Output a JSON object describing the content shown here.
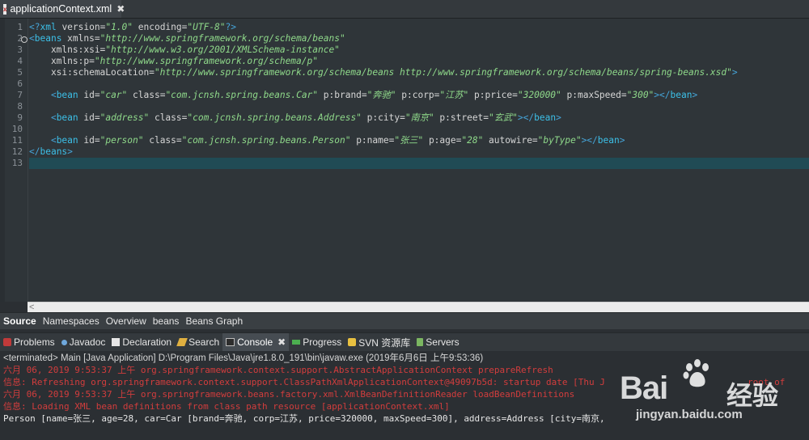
{
  "editor_tab": {
    "label": "applicationContext.xml",
    "close": "✖"
  },
  "line_numbers": [
    "1",
    "2",
    "3",
    "4",
    "5",
    "6",
    "7",
    "8",
    "9",
    "10",
    "11",
    "12",
    "13"
  ],
  "code": {
    "l1": {
      "p1": "<?",
      "t": "xml",
      "a1": " version=",
      "v1": "\"1.0\"",
      "a2": " encoding=",
      "v2": "\"UTF-8\"",
      "p2": "?>"
    },
    "l2": {
      "p1": "<",
      "t": "beans",
      "a1": " xmlns=",
      "v1": "\"http://www.springframework.org/schema/beans\""
    },
    "l3": {
      "a1": "    xmlns:xsi=",
      "v1": "\"http://www.w3.org/2001/XMLSchema-instance\""
    },
    "l4": {
      "a1": "    xmlns:p=",
      "v1": "\"http://www.springframework.org/schema/p\""
    },
    "l5": {
      "a1": "    xsi:schemaLocation=",
      "v1": "\"http://www.springframework.org/schema/beans http://www.springframework.org/schema/beans/spring-beans.xsd\"",
      "p2": ">"
    },
    "l7": {
      "p1": "    <",
      "t": "bean",
      "a1": " id=",
      "v1": "\"car\"",
      "a2": " class=",
      "v2": "\"com.jcnsh.spring.beans.Car\"",
      "a3": " p:brand=",
      "v3": "\"奔驰\"",
      "a4": " p:corp=",
      "v4": "\"江苏\"",
      "a5": " p:price=",
      "v5": "\"320000\"",
      "a6": " p:maxSpeed=",
      "v6": "\"300\"",
      "p2": "></",
      "t2": "bean",
      "p3": ">"
    },
    "l9": {
      "p1": "    <",
      "t": "bean",
      "a1": " id=",
      "v1": "\"address\"",
      "a2": " class=",
      "v2": "\"com.jcnsh.spring.beans.Address\"",
      "a3": " p:city=",
      "v3": "\"南京\"",
      "a4": " p:street=",
      "v4": "\"玄武\"",
      "p2": "></",
      "t2": "bean",
      "p3": ">"
    },
    "l11": {
      "p1": "    <",
      "t": "bean",
      "a1": " id=",
      "v1": "\"person\"",
      "a2": " class=",
      "v2": "\"com.jcnsh.spring.beans.Person\"",
      "a3": " p:name=",
      "v3": "\"张三\"",
      "a4": " p:age=",
      "v4": "\"28\"",
      "a5": " autowire=",
      "v5": "\"byType\"",
      "p2": "></",
      "t2": "bean",
      "p3": ">"
    },
    "l12": {
      "p1": "</",
      "t": "beans",
      "p2": ">"
    }
  },
  "page_tabs": [
    "Source",
    "Namespaces",
    "Overview",
    "beans",
    "Beans Graph"
  ],
  "view_tabs": [
    "Problems",
    "Javadoc",
    "Declaration",
    "Search",
    "Console",
    "Progress",
    "SVN 资源库",
    "Servers"
  ],
  "view_tab_close": "✖",
  "console": {
    "status": "<terminated> Main [Java Application] D:\\Program Files\\Java\\jre1.8.0_191\\bin\\javaw.exe (2019年6月6日 上午9:53:36)",
    "lines": [
      "六月 06, 2019 9:53:37 上午 org.springframework.context.support.AbstractApplicationContext prepareRefresh",
      "信息: Refreshing org.springframework.context.support.ClassPathXmlApplicationContext@49097b5d: startup date [Thu J",
      "六月 06, 2019 9:53:37 上午 org.springframework.beans.factory.xml.XmlBeanDefinitionReader loadBeanDefinitions",
      "信息: Loading XML bean definitions from class path resource [applicationContext.xml]",
      "Person [name=张三, age=28, car=Car [brand=奔驰, corp=江苏, price=320000, maxSpeed=300], address=Address [city=南京,"
    ],
    "line2_tail": "root of"
  },
  "watermark": {
    "brand": "Bai",
    "brand_cn": "经验",
    "url": "jingyan.baidu.com"
  },
  "colors": {
    "tag": "#3cc0e8",
    "value": "#8fd98a",
    "error": "#d33d3d",
    "current_line": "#204b55"
  }
}
